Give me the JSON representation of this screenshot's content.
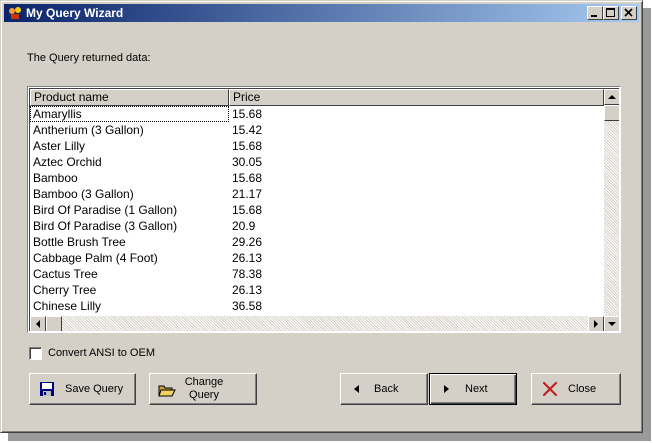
{
  "window": {
    "title": "My Query Wizard"
  },
  "main": {
    "returned_label": "The Query returned data:",
    "columns": [
      "Product name",
      "Price"
    ],
    "rows": [
      [
        "Amaryllis",
        "15.68"
      ],
      [
        "Antherium (3 Gallon)",
        "15.42"
      ],
      [
        "Aster Lilly",
        "15.68"
      ],
      [
        "Aztec Orchid",
        "30.05"
      ],
      [
        "Bamboo",
        "15.68"
      ],
      [
        "Bamboo (3 Gallon)",
        "21.17"
      ],
      [
        "Bird Of Paradise (1 Gallon)",
        "15.68"
      ],
      [
        "Bird Of Paradise (3 Gallon)",
        "20.9"
      ],
      [
        "Bottle Brush Tree",
        "29.26"
      ],
      [
        "Cabbage Palm (4 Foot)",
        "26.13"
      ],
      [
        "Cactus Tree",
        "78.38"
      ],
      [
        "Cherry Tree",
        "26.13"
      ],
      [
        "Chinese Lilly",
        "36.58"
      ]
    ],
    "convert_label": "Convert ANSI to OEM"
  },
  "buttons": {
    "save_query": "Save Query",
    "change_query_line1": "Change",
    "change_query_line2": "Query",
    "back": "Back",
    "next": "Next",
    "close": "Close"
  }
}
